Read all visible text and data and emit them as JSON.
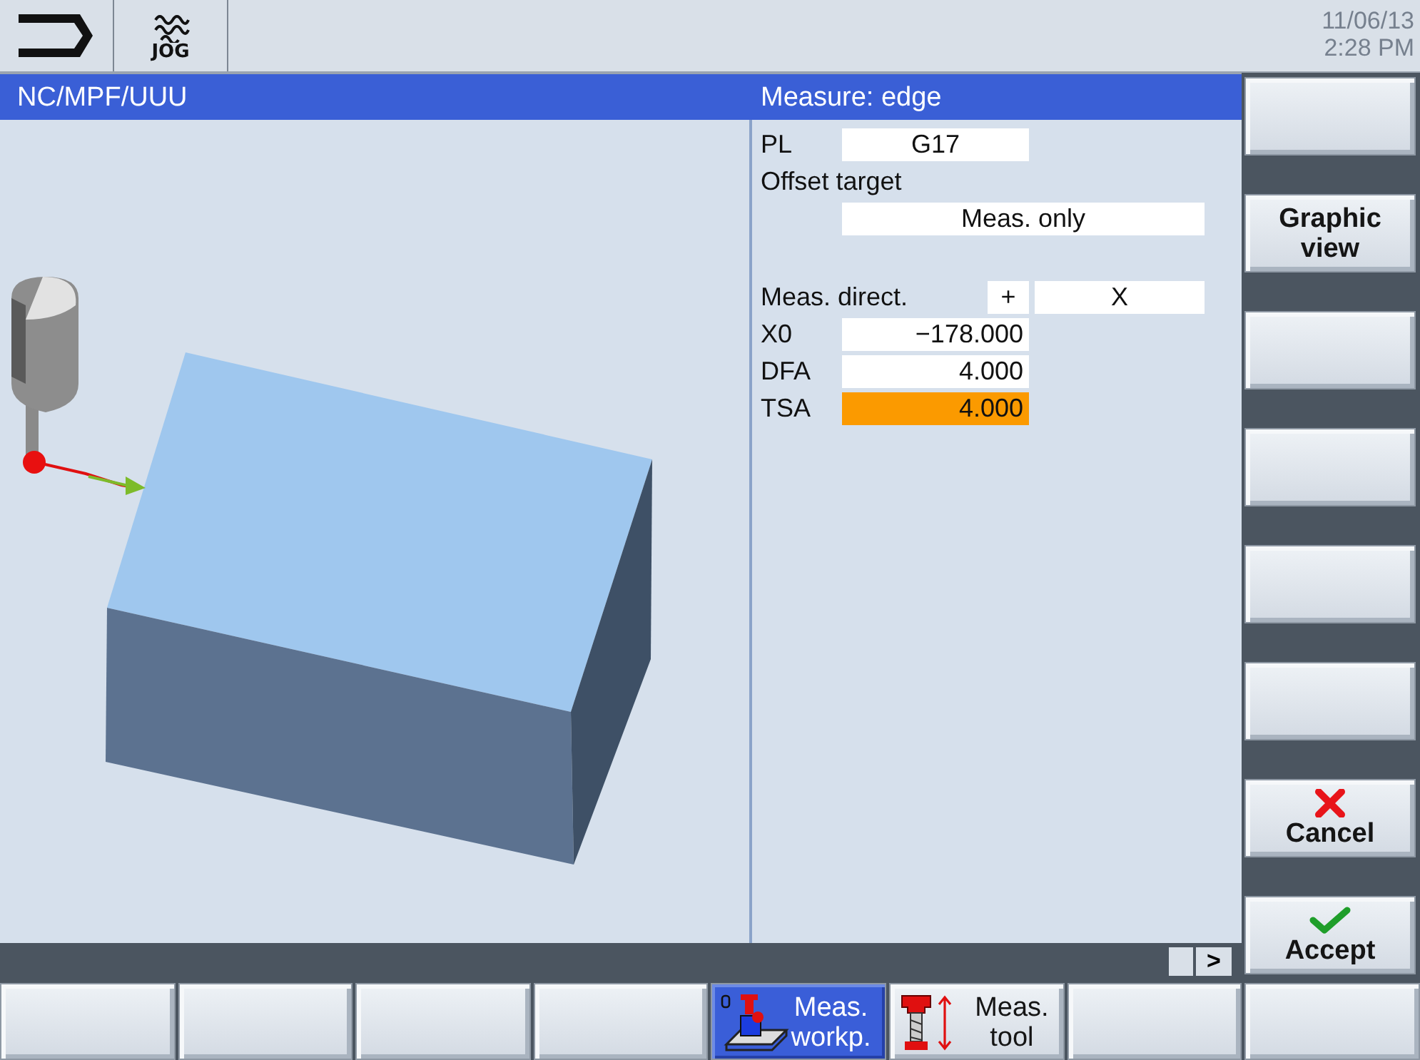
{
  "top_bar": {
    "mode_label": "JOG",
    "date": "11/06/13",
    "time": "2:28 PM"
  },
  "title_bar": {
    "path": "NC/MPF/UUU",
    "title": "Measure: edge"
  },
  "form": {
    "rows": [
      {
        "kind": "choice_field",
        "label": "PL",
        "value": "G17",
        "focused": false
      },
      {
        "kind": "heading",
        "label": "Offset target"
      },
      {
        "kind": "wide_field",
        "value": "Meas. only"
      },
      {
        "kind": "direction",
        "label": "Meas. direct.",
        "sign": "+",
        "axis": "X"
      },
      {
        "kind": "number_field",
        "label": "X0",
        "value": "−178.000",
        "focused": false
      },
      {
        "kind": "number_field",
        "label": "DFA",
        "value": "4.000",
        "focused": false
      },
      {
        "kind": "number_field",
        "label": "TSA",
        "value": "4.000",
        "focused": true
      }
    ]
  },
  "scroll_bar": {
    "arrow": ">"
  },
  "vertical_softkeys": [
    {
      "kind": "blank"
    },
    {
      "kind": "text",
      "lines": [
        "Graphic",
        "view"
      ]
    },
    {
      "kind": "blank"
    },
    {
      "kind": "blank"
    },
    {
      "kind": "blank"
    },
    {
      "kind": "blank"
    },
    {
      "kind": "cancel",
      "lines": [
        "Cancel"
      ]
    },
    {
      "kind": "accept",
      "lines": [
        "Accept"
      ]
    }
  ],
  "horizontal_softkeys": [
    {
      "kind": "blank",
      "selected": false
    },
    {
      "kind": "blank",
      "selected": false
    },
    {
      "kind": "blank",
      "selected": false
    },
    {
      "kind": "blank",
      "selected": false
    },
    {
      "kind": "measure_workpiece",
      "lines": [
        "Meas.",
        "workp."
      ],
      "selected": true
    },
    {
      "kind": "measure_tool",
      "lines": [
        "Meas.",
        "tool"
      ],
      "selected": false
    },
    {
      "kind": "blank",
      "selected": false
    },
    {
      "kind": "blank",
      "selected": false
    }
  ]
}
